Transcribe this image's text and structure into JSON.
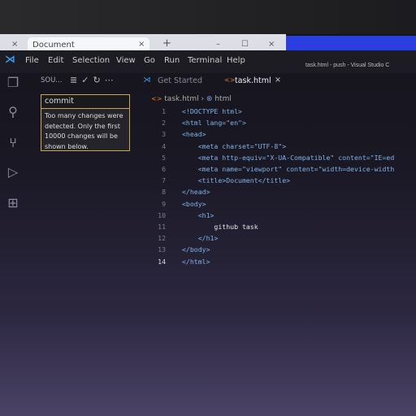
{
  "browser": {
    "tab_title": "Document",
    "close": "×",
    "new_tab": "+",
    "min": "–",
    "max": "☐",
    "close_window": "×"
  },
  "menu": [
    "File",
    "Edit",
    "Selection",
    "View",
    "Go",
    "Run",
    "Terminal",
    "Help"
  ],
  "window_title": "task.html - push - Visual Studio C",
  "sidebar": {
    "title": "SOU...",
    "commit_placeholder": "commit",
    "tooltip": "Too many changes were detected. Only the first 10000 changes will be shown below."
  },
  "tabs": [
    {
      "label": "Get Started"
    },
    {
      "label": "task.html",
      "active": true
    }
  ],
  "breadcrumb": [
    "task.html",
    "html"
  ],
  "code_lines": [
    "<!DOCTYPE html>",
    "<html lang=\"en\">",
    "<head>",
    "    <meta charset=\"UTF-8\">",
    "    <meta http-equiv=\"X-UA-Compatible\" content=\"IE=ed",
    "    <meta name=\"viewport\" content=\"width=device-width",
    "    <title>Document</title>",
    "</head>",
    "<body>",
    "    <h1>",
    "        github task",
    "    </h1>",
    "</body>",
    "</html>"
  ],
  "colors": {
    "accent": "#2b3fe0",
    "tag": "#569cd6",
    "attr": "#9cdcfe",
    "string": "#ce9178"
  }
}
